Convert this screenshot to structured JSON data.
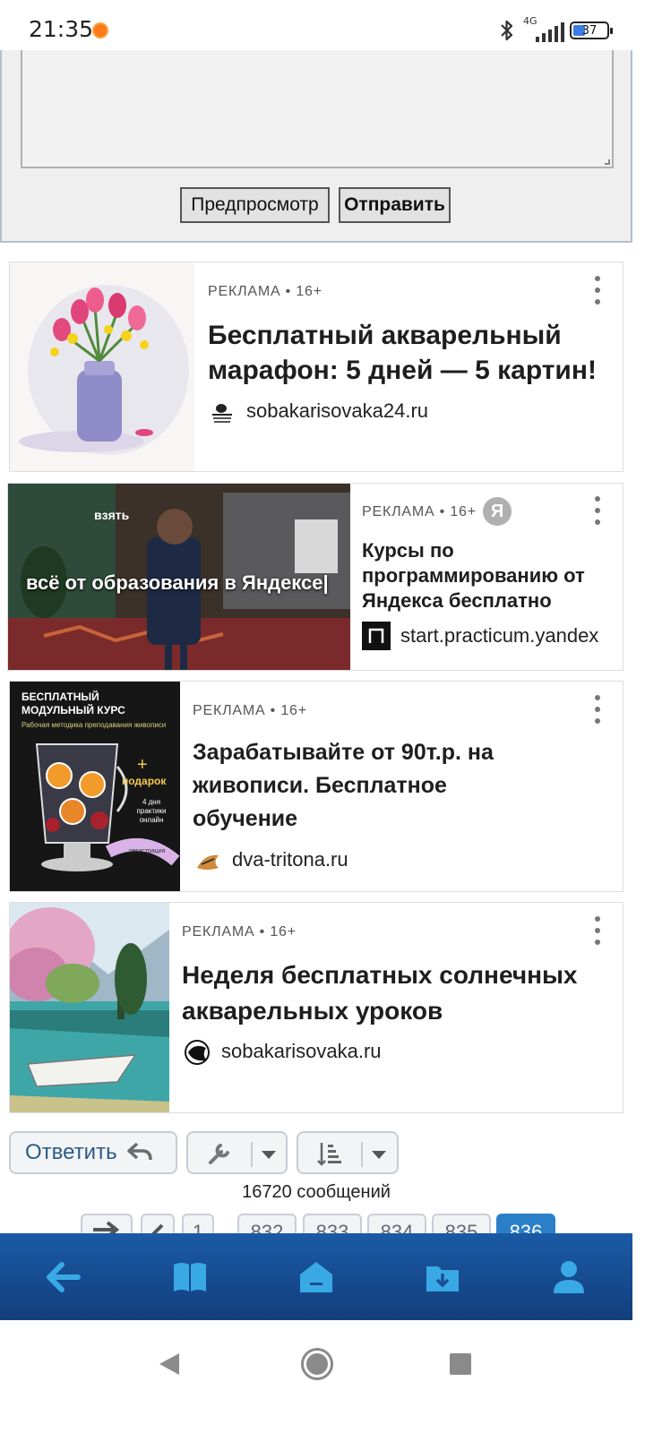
{
  "status_bar": {
    "time": "21:35",
    "network": "4G",
    "battery": "37",
    "battery_level": 0.37,
    "notification_color": "#ff7a1a"
  },
  "form": {
    "preview_label": "Предпросмотр",
    "send_label": "Отправить"
  },
  "ads": [
    {
      "meta": "РЕКЛАМА • 16+",
      "title": "Бесплатный акварельный марафон: 5 дней — 5 картин!",
      "domain": "sobakarisovaka24.ru",
      "image": "watercolor-tulips-illustration"
    },
    {
      "meta": "РЕКЛАМА • 16+",
      "badge": "Я",
      "title": "Курсы по программированию от Яндекса бесплатно",
      "domain": "start.practicum.yandex",
      "image_overlay_top": "взять",
      "image_overlay_text": "всё от образования в Яндексе|"
    },
    {
      "meta": "РЕКЛАМА • 16+",
      "title": "Зарабатывайте от 90т.р. на живописи. Бесплатное обучение",
      "domain": "dva-tritona.ru",
      "image_heading": "БЕСПЛАТНЫЙ МОДУЛЬНЫЙ КУРС",
      "image_subheading": "Рабочая методика преподавания живописи",
      "image_plus": "+",
      "image_gift": "подарок",
      "image_days": "4 дня практики онлайн",
      "image_register": "регистрация"
    },
    {
      "meta": "РЕКЛАМА • 16+",
      "title": "Неделя бесплатных солнечных акварельных уроков",
      "domain": "sobakarisovaka.ru",
      "image": "watercolor-lake-boat-illustration"
    }
  ],
  "controls": {
    "reply_label": "Ответить",
    "message_count": "16720 сообщений"
  },
  "pagination": {
    "pages": [
      "1",
      "832",
      "833",
      "834",
      "835",
      "836"
    ],
    "active": "836"
  },
  "app_nav": [
    "back-arrow-icon",
    "book-icon",
    "home-icon",
    "download-icon",
    "user-icon"
  ],
  "colors": {
    "nav_bg": "#1b5aa6",
    "nav_icon": "#39a9e6",
    "accent": "#2b7fc9",
    "reply_text": "#2a5b88"
  }
}
